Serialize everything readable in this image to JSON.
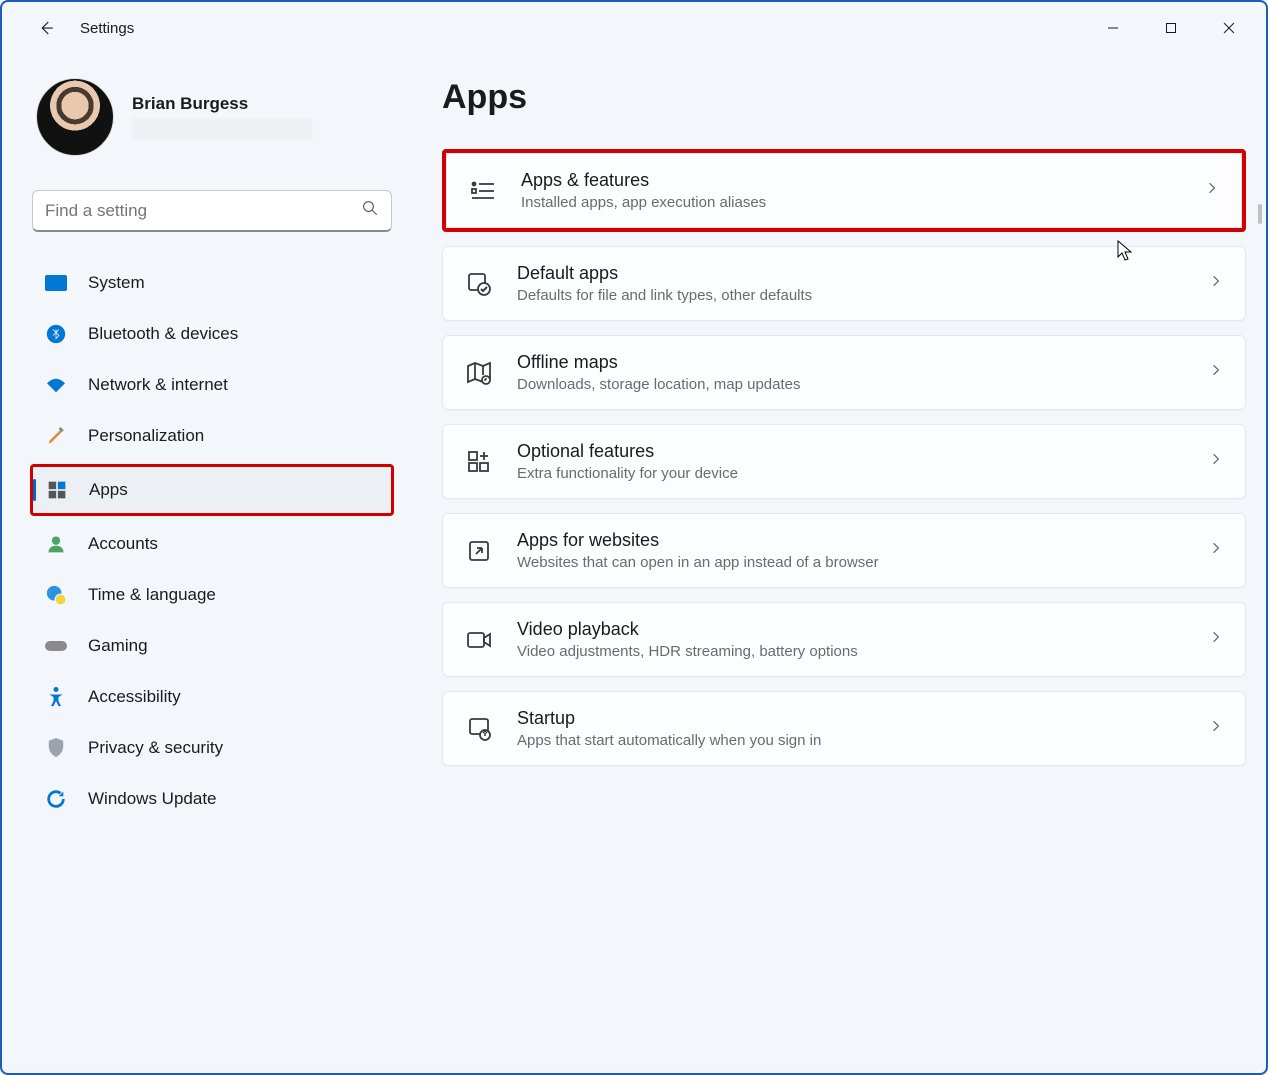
{
  "window": {
    "title": "Settings"
  },
  "profile": {
    "name": "Brian Burgess"
  },
  "search": {
    "placeholder": "Find a setting"
  },
  "nav": {
    "items": [
      {
        "label": "System"
      },
      {
        "label": "Bluetooth & devices"
      },
      {
        "label": "Network & internet"
      },
      {
        "label": "Personalization"
      },
      {
        "label": "Apps"
      },
      {
        "label": "Accounts"
      },
      {
        "label": "Time & language"
      },
      {
        "label": "Gaming"
      },
      {
        "label": "Accessibility"
      },
      {
        "label": "Privacy & security"
      },
      {
        "label": "Windows Update"
      }
    ]
  },
  "page": {
    "title": "Apps",
    "cards": [
      {
        "title": "Apps & features",
        "subtitle": "Installed apps, app execution aliases"
      },
      {
        "title": "Default apps",
        "subtitle": "Defaults for file and link types, other defaults"
      },
      {
        "title": "Offline maps",
        "subtitle": "Downloads, storage location, map updates"
      },
      {
        "title": "Optional features",
        "subtitle": "Extra functionality for your device"
      },
      {
        "title": "Apps for websites",
        "subtitle": "Websites that can open in an app instead of a browser"
      },
      {
        "title": "Video playback",
        "subtitle": "Video adjustments, HDR streaming, battery options"
      },
      {
        "title": "Startup",
        "subtitle": "Apps that start automatically when you sign in"
      }
    ]
  }
}
